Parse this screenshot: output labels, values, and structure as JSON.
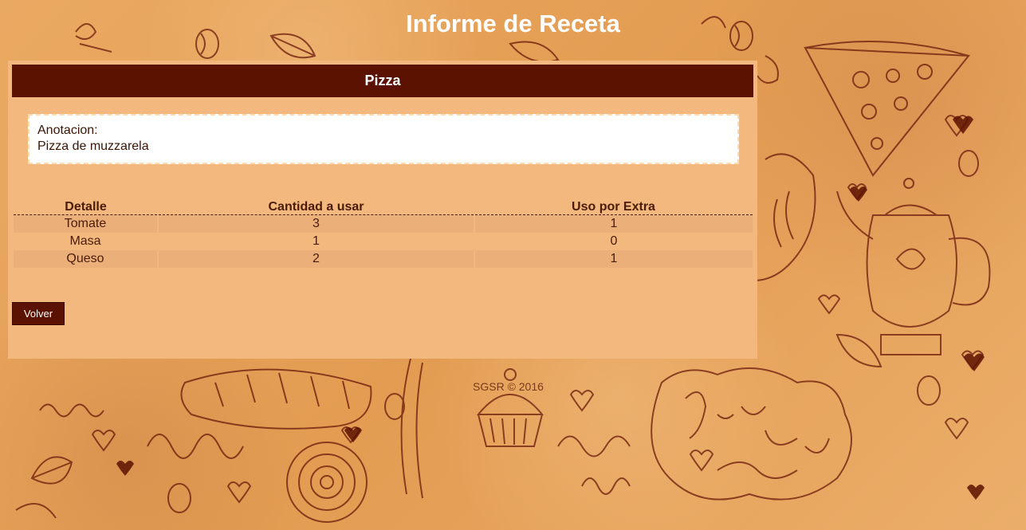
{
  "page": {
    "title": "Informe de Receta",
    "footer": "SGSR © 2016"
  },
  "recipe": {
    "name": "Pizza",
    "annotation_label": "Anotacion:",
    "annotation_text": "Pizza de muzzarela"
  },
  "table": {
    "headers": [
      "Detalle",
      "Cantidad a usar",
      "Uso por Extra"
    ],
    "rows": [
      [
        "Tomate",
        "3",
        "1"
      ],
      [
        "Masa",
        "1",
        "0"
      ],
      [
        "Queso",
        "2",
        "1"
      ]
    ]
  },
  "actions": {
    "back_label": "Volver"
  },
  "colors": {
    "header_bg": "#5c1200",
    "panel_bg": "#f3b87d",
    "page_bg": "#e8a65e"
  }
}
